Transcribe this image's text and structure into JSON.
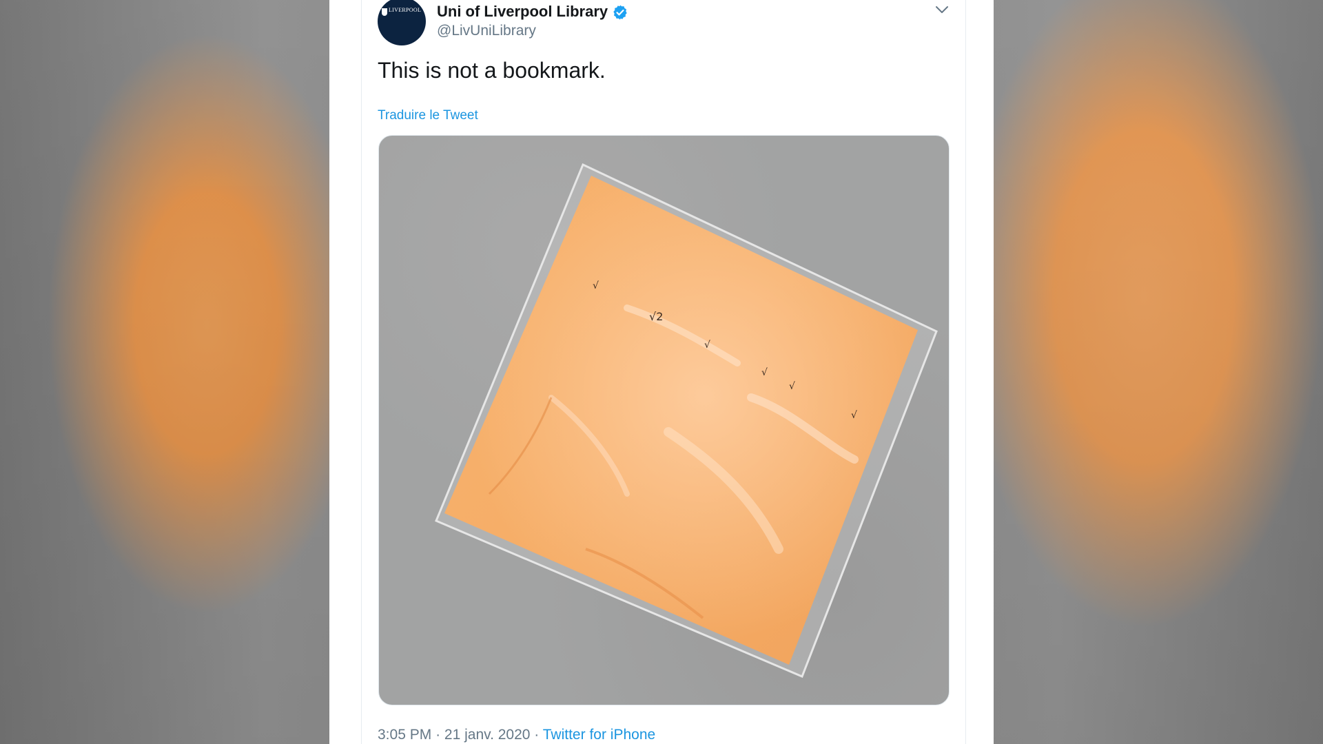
{
  "tweet": {
    "display_name": "Uni of Liverpool Library",
    "handle": "@LivUniLibrary",
    "text": "This is not a bookmark.",
    "translate_label": "Traduire le Tweet",
    "time": "3:05 PM",
    "date": "21 janv. 2020",
    "separator": "·",
    "source": "Twitter for iPhone",
    "avatar_logo_text": "LIVERPOOL",
    "media_description_icon": "cheese-slice-photo"
  },
  "icons": {
    "verified": "verified-badge-icon",
    "caret": "chevron-down-icon"
  },
  "colors": {
    "link_blue": "#1b95e0",
    "text_dark": "#14171a",
    "text_grey": "#657786",
    "verified_blue": "#1da1f2"
  }
}
